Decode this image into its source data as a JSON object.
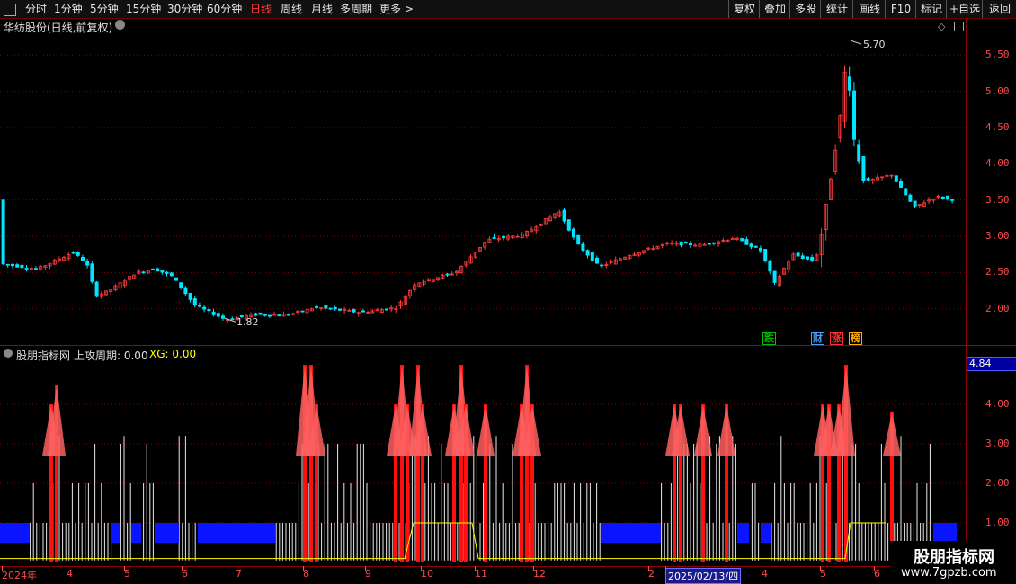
{
  "toolbar": {
    "items": [
      "分时",
      "1分钟",
      "5分钟",
      "15分钟",
      "30分钟",
      "60分钟",
      "日线",
      "周线",
      "月线",
      "多周期",
      "更多 >"
    ],
    "active": "日线",
    "right": [
      "复权",
      "叠加",
      "多股",
      "统计",
      "画线",
      "F10",
      "标记",
      "+自选",
      "返回"
    ]
  },
  "main_title": "华纺股份(日线,前复权)",
  "indicator_title": {
    "name": "股朋指标网",
    "param1": "上攻周期: 0.00",
    "param2": "XG: 0.00"
  },
  "price_axis": [
    "5.50",
    "5.00",
    "4.50",
    "4.00",
    "3.50",
    "3.00",
    "2.50",
    "2.00"
  ],
  "indicator_axis": [
    "4.00",
    "3.00",
    "2.00",
    "1.00"
  ],
  "indicator_current": "4.84",
  "annotations": {
    "high": "5.70",
    "low": "1.82"
  },
  "badges": [
    {
      "text": "跌",
      "color": "#00c000"
    },
    {
      "text": "财",
      "color": "#4aa0ff"
    },
    {
      "text": "涨",
      "color": "#ff3030"
    },
    {
      "text": "榜",
      "color": "#ffaa00"
    }
  ],
  "date_axis": [
    "2024年",
    "4",
    "5",
    "6",
    "7",
    "8",
    "9",
    "10",
    "11",
    "12",
    "2",
    "2025/02/13/四",
    "4",
    "5",
    "6"
  ],
  "watermark": {
    "brand": "股朋指标网",
    "url": "www.7gpzb.com"
  },
  "colors": {
    "up": "#ff3b3b",
    "down": "#00e5ff",
    "axis": "#ff4a4a",
    "grid": "#8b0000"
  },
  "chart_data": [
    {
      "type": "candlestick",
      "title": "华纺股份(日线,前复权)",
      "ylim": [
        1.6,
        5.9
      ],
      "close_path": [
        [
          0,
          2.62
        ],
        [
          40,
          2.55
        ],
        [
          80,
          2.78
        ],
        [
          95,
          2.62
        ],
        [
          105,
          2.18
        ],
        [
          120,
          2.25
        ],
        [
          150,
          2.5
        ],
        [
          170,
          2.55
        ],
        [
          190,
          2.45
        ],
        [
          215,
          2.05
        ],
        [
          250,
          1.85
        ],
        [
          280,
          1.92
        ],
        [
          320,
          1.92
        ],
        [
          350,
          2.02
        ],
        [
          400,
          1.95
        ],
        [
          440,
          2.02
        ],
        [
          460,
          2.35
        ],
        [
          480,
          2.42
        ],
        [
          505,
          2.5
        ],
        [
          540,
          2.95
        ],
        [
          580,
          3.02
        ],
        [
          620,
          3.35
        ],
        [
          640,
          2.9
        ],
        [
          665,
          2.58
        ],
        [
          700,
          2.75
        ],
        [
          740,
          2.9
        ],
        [
          780,
          2.88
        ],
        [
          815,
          2.98
        ],
        [
          845,
          2.8
        ],
        [
          860,
          2.35
        ],
        [
          880,
          2.75
        ],
        [
          905,
          2.65
        ],
        [
          915,
          3.2
        ],
        [
          925,
          4.05
        ],
        [
          935,
          4.8
        ],
        [
          940,
          5.55
        ],
        [
          948,
          4.35
        ],
        [
          960,
          3.75
        ],
        [
          990,
          3.85
        ],
        [
          1015,
          3.4
        ],
        [
          1040,
          3.55
        ],
        [
          1060,
          3.5
        ]
      ],
      "high": 5.7,
      "low": 1.82
    },
    {
      "type": "bar",
      "title": "股朋指标网",
      "ylim": [
        0,
        5.0
      ],
      "series_levels": [
        1,
        2,
        3,
        4
      ],
      "blue_zones": [
        [
          0,
          33
        ],
        [
          124,
          133
        ],
        [
          146,
          157
        ],
        [
          172,
          199
        ],
        [
          220,
          306
        ],
        [
          668,
          735
        ],
        [
          820,
          833
        ],
        [
          846,
          858
        ],
        [
          1038,
          1064
        ]
      ],
      "red_spikes": [
        {
          "x": 57,
          "v": 4
        },
        {
          "x": 63,
          "v": 4.5
        },
        {
          "x": 339,
          "v": 5
        },
        {
          "x": 346,
          "v": 5
        },
        {
          "x": 352,
          "v": 4
        },
        {
          "x": 440,
          "v": 4
        },
        {
          "x": 447,
          "v": 5
        },
        {
          "x": 453,
          "v": 4
        },
        {
          "x": 465,
          "v": 5
        },
        {
          "x": 470,
          "v": 4
        },
        {
          "x": 505,
          "v": 4
        },
        {
          "x": 513,
          "v": 5
        },
        {
          "x": 518,
          "v": 4
        },
        {
          "x": 540,
          "v": 4
        },
        {
          "x": 580,
          "v": 4
        },
        {
          "x": 586,
          "v": 5
        },
        {
          "x": 592,
          "v": 4
        },
        {
          "x": 750,
          "v": 4
        },
        {
          "x": 757,
          "v": 4
        },
        {
          "x": 782,
          "v": 4
        },
        {
          "x": 808,
          "v": 4
        },
        {
          "x": 915,
          "v": 4
        },
        {
          "x": 922,
          "v": 4
        },
        {
          "x": 933,
          "v": 4
        },
        {
          "x": 941,
          "v": 5
        },
        {
          "x": 992,
          "v": 3.8
        }
      ],
      "yellow_line": [
        [
          0,
          0.1
        ],
        [
          450,
          0.1
        ],
        [
          460,
          1
        ],
        [
          525,
          1
        ],
        [
          532,
          0.1
        ],
        [
          940,
          0.1
        ],
        [
          946,
          1
        ],
        [
          985,
          1
        ]
      ]
    }
  ]
}
